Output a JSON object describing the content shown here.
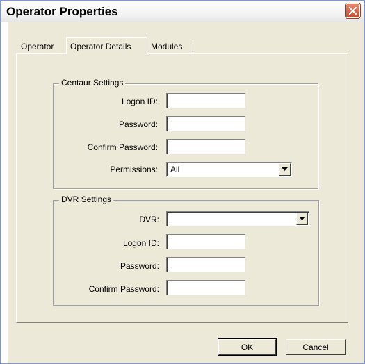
{
  "window": {
    "title": "Operator Properties"
  },
  "tabs": [
    {
      "label": "Operator"
    },
    {
      "label": "Operator Details",
      "active": true
    },
    {
      "label": "Modules"
    }
  ],
  "centaur": {
    "legend": "Centaur Settings",
    "logon_id_label": "Logon ID:",
    "password_label": "Password:",
    "confirm_label": "Confirm Password:",
    "permissions_label": "Permissions:",
    "logon_id_value": "",
    "password_value": "",
    "confirm_value": "",
    "permissions_value": "All"
  },
  "dvr": {
    "legend": "DVR Settings",
    "dvr_label": "DVR:",
    "dvr_value": "",
    "logon_id_label": "Logon ID:",
    "password_label": "Password:",
    "confirm_label": "Confirm Password:"
  },
  "buttons": {
    "ok": "OK",
    "cancel": "Cancel"
  },
  "colors": {
    "face": "#ece9d8",
    "close": "#c24a2e"
  }
}
